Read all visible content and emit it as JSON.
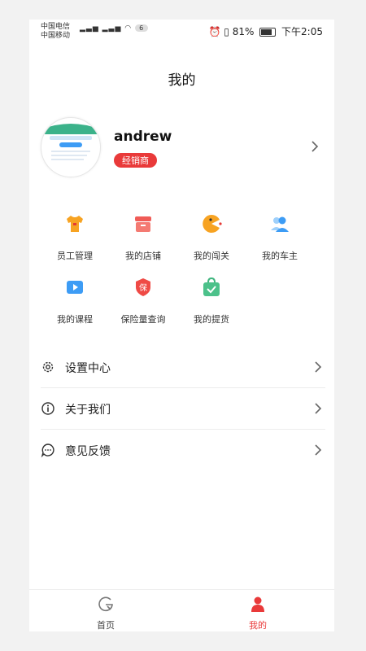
{
  "status_bar": {
    "carrier_1": "中国电信",
    "carrier_2": "中国移动",
    "badge": "6",
    "battery_text": "81%",
    "time": "下午2:05"
  },
  "page": {
    "title": "我的"
  },
  "profile": {
    "name": "andrew",
    "role": "经销商"
  },
  "grid": {
    "items": [
      {
        "label": "员工管理",
        "icon": "tshirt-icon"
      },
      {
        "label": "我的店铺",
        "icon": "store-icon"
      },
      {
        "label": "我的闯关",
        "icon": "pacman-icon"
      },
      {
        "label": "我的车主",
        "icon": "users-icon"
      },
      {
        "label": "我的课程",
        "icon": "play-icon"
      },
      {
        "label": "保险量查询",
        "icon": "shield-icon"
      },
      {
        "label": "我的提货",
        "icon": "shopping-bag-icon"
      }
    ],
    "shield_char": "保"
  },
  "menu": {
    "items": [
      {
        "label": "设置中心",
        "icon": "gear-icon"
      },
      {
        "label": "关于我们",
        "icon": "info-icon"
      },
      {
        "label": "意见反馈",
        "icon": "chat-icon"
      }
    ]
  },
  "tabbar": {
    "home": "首页",
    "mine": "我的"
  },
  "colors": {
    "accent": "#e93a3a",
    "orange": "#f7a322",
    "blue": "#3d9cf5",
    "green": "#4cc18a"
  }
}
